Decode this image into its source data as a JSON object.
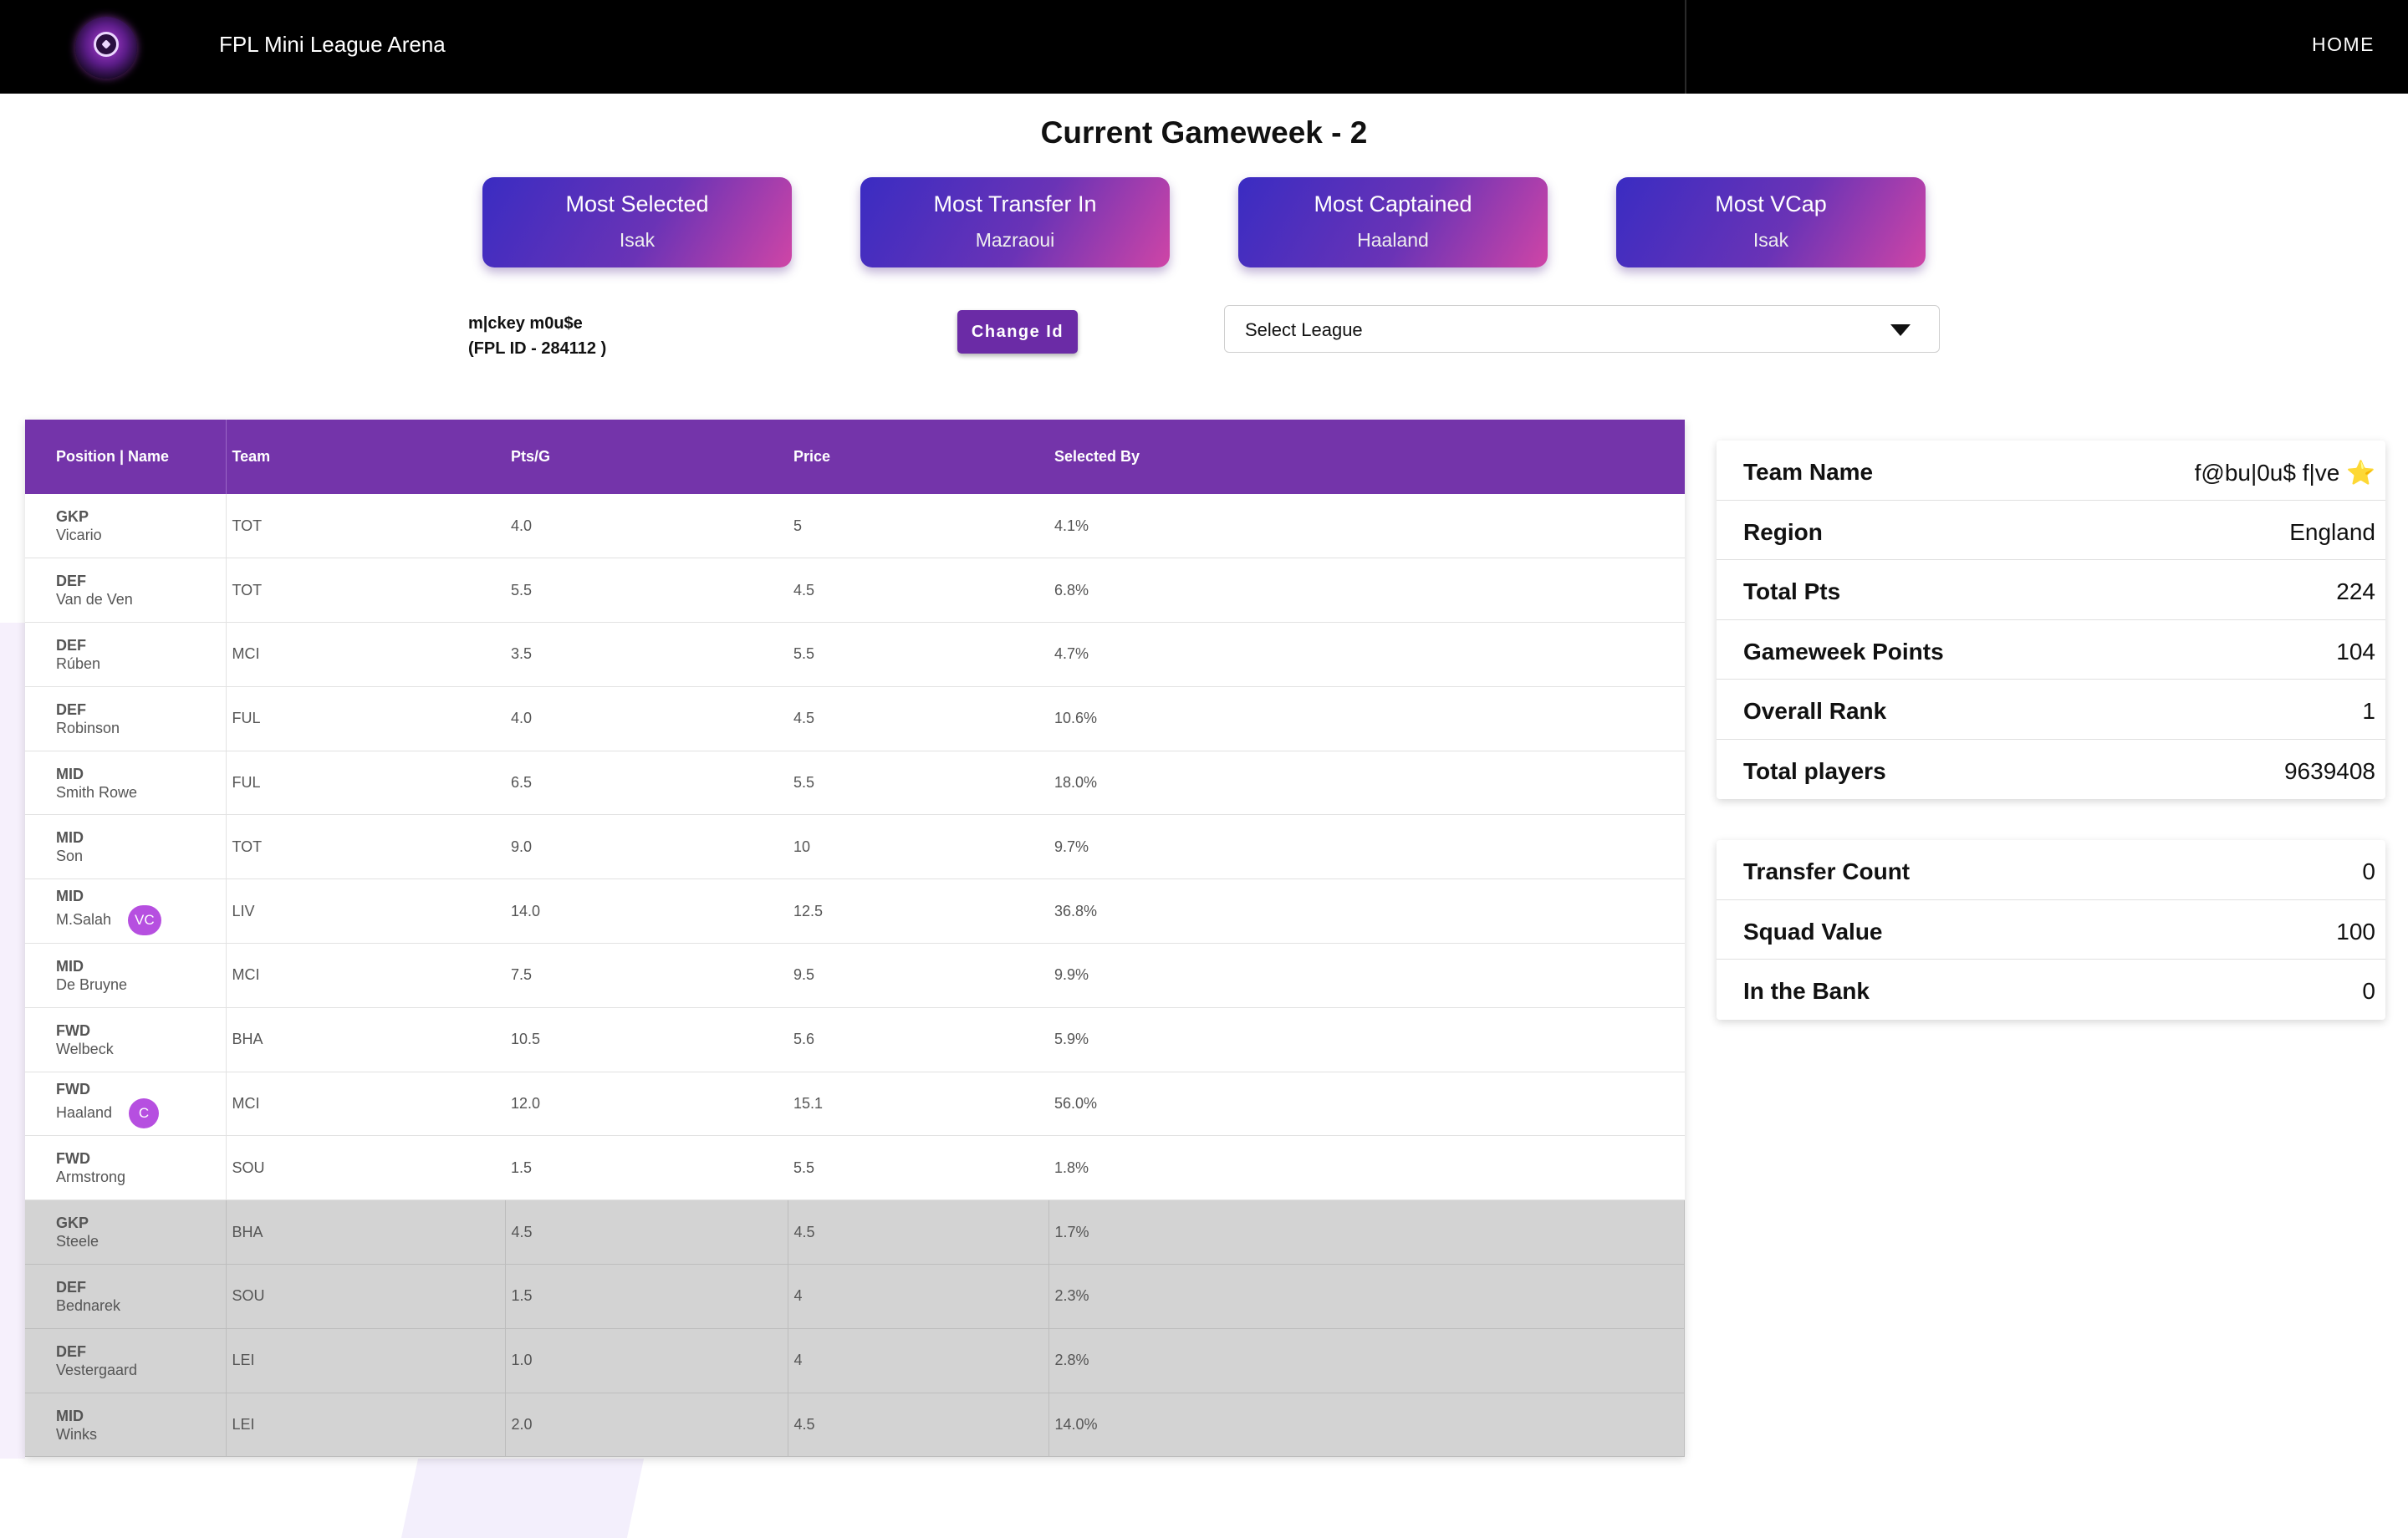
{
  "header": {
    "app_title": "FPL Mini League Arena",
    "home_label": "HOME"
  },
  "page_title": "Current Gameweek - 2",
  "stat_cards": [
    {
      "label": "Most Selected",
      "value": "Isak"
    },
    {
      "label": "Most Transfer In",
      "value": "Mazraoui"
    },
    {
      "label": "Most Captained",
      "value": "Haaland"
    },
    {
      "label": "Most VCap",
      "value": "Isak"
    }
  ],
  "user": {
    "name": "m|ckey m0u$e",
    "fpl_id": "(FPL ID - 284112 )",
    "change_id_label": "Change Id"
  },
  "league_select": {
    "selected": "Select League"
  },
  "squad": {
    "columns": [
      "Position | Name",
      "Team",
      "Pts/G",
      "Price",
      "Selected By"
    ],
    "rows": [
      {
        "pos": "GKP",
        "name": "Vicario",
        "team": "TOT",
        "ptsg": "4.0",
        "price": "5",
        "selected": "4.1%",
        "badge": "",
        "bench": false
      },
      {
        "pos": "DEF",
        "name": "Van de Ven",
        "team": "TOT",
        "ptsg": "5.5",
        "price": "4.5",
        "selected": "6.8%",
        "badge": "",
        "bench": false
      },
      {
        "pos": "DEF",
        "name": "Rúben",
        "team": "MCI",
        "ptsg": "3.5",
        "price": "5.5",
        "selected": "4.7%",
        "badge": "",
        "bench": false
      },
      {
        "pos": "DEF",
        "name": "Robinson",
        "team": "FUL",
        "ptsg": "4.0",
        "price": "4.5",
        "selected": "10.6%",
        "badge": "",
        "bench": false
      },
      {
        "pos": "MID",
        "name": "Smith Rowe",
        "team": "FUL",
        "ptsg": "6.5",
        "price": "5.5",
        "selected": "18.0%",
        "badge": "",
        "bench": false
      },
      {
        "pos": "MID",
        "name": "Son",
        "team": "TOT",
        "ptsg": "9.0",
        "price": "10",
        "selected": "9.7%",
        "badge": "",
        "bench": false
      },
      {
        "pos": "MID",
        "name": "M.Salah",
        "team": "LIV",
        "ptsg": "14.0",
        "price": "12.5",
        "selected": "36.8%",
        "badge": "VC",
        "bench": false
      },
      {
        "pos": "MID",
        "name": "De Bruyne",
        "team": "MCI",
        "ptsg": "7.5",
        "price": "9.5",
        "selected": "9.9%",
        "badge": "",
        "bench": false
      },
      {
        "pos": "FWD",
        "name": "Welbeck",
        "team": "BHA",
        "ptsg": "10.5",
        "price": "5.6",
        "selected": "5.9%",
        "badge": "",
        "bench": false
      },
      {
        "pos": "FWD",
        "name": "Haaland",
        "team": "MCI",
        "ptsg": "12.0",
        "price": "15.1",
        "selected": "56.0%",
        "badge": "C",
        "bench": false
      },
      {
        "pos": "FWD",
        "name": "Armstrong",
        "team": "SOU",
        "ptsg": "1.5",
        "price": "5.5",
        "selected": "1.8%",
        "badge": "",
        "bench": false
      },
      {
        "pos": "GKP",
        "name": "Steele",
        "team": "BHA",
        "ptsg": "4.5",
        "price": "4.5",
        "selected": "1.7%",
        "badge": "",
        "bench": true
      },
      {
        "pos": "DEF",
        "name": "Bednarek",
        "team": "SOU",
        "ptsg": "1.5",
        "price": "4",
        "selected": "2.3%",
        "badge": "",
        "bench": true
      },
      {
        "pos": "DEF",
        "name": "Vestergaard",
        "team": "LEI",
        "ptsg": "1.0",
        "price": "4",
        "selected": "2.8%",
        "badge": "",
        "bench": true
      },
      {
        "pos": "MID",
        "name": "Winks",
        "team": "LEI",
        "ptsg": "2.0",
        "price": "4.5",
        "selected": "14.0%",
        "badge": "",
        "bench": true
      }
    ]
  },
  "team_info": [
    {
      "key": "Team Name",
      "value": "f@bu|0u$ f|ve ⭐"
    },
    {
      "key": "Region",
      "value": "England"
    },
    {
      "key": "Total Pts",
      "value": "224"
    },
    {
      "key": "Gameweek Points",
      "value": "104"
    },
    {
      "key": "Overall Rank",
      "value": "1"
    },
    {
      "key": "Total players",
      "value": "9639408"
    }
  ],
  "finance_info": [
    {
      "key": "Transfer Count",
      "value": "0"
    },
    {
      "key": "Squad Value",
      "value": "100"
    },
    {
      "key": "In the Bank",
      "value": "0"
    }
  ],
  "colors": {
    "header_bg": "#000000",
    "table_header": "#7434aa",
    "card_gradient_start": "#3a2cc2",
    "card_gradient_end": "#cf45a6",
    "badge": "#b64fe0",
    "bench_row": "#d3d3d3"
  }
}
